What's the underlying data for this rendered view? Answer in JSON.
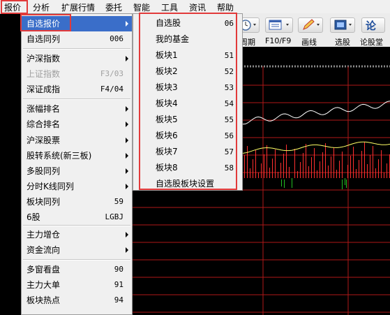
{
  "menubar": {
    "items": [
      "报价",
      "分析",
      "扩展行情",
      "委托",
      "智能",
      "工具",
      "资讯",
      "帮助"
    ]
  },
  "toolbar": {
    "labels": [
      "周期",
      "F10/F9",
      "画线",
      "选股",
      "论股堂"
    ]
  },
  "menu": {
    "items": [
      {
        "label": "自选报价",
        "shortcut": "",
        "submenu": true,
        "highlighted": true
      },
      {
        "label": "自选同列",
        "shortcut": "006"
      },
      {
        "label": "沪深指数",
        "shortcut": "",
        "submenu": true
      },
      {
        "label": "上证指数",
        "shortcut": "F3/03",
        "disabled": true
      },
      {
        "label": "深证成指",
        "shortcut": "F4/04"
      },
      {
        "label": "涨幅排名",
        "shortcut": "",
        "submenu": true
      },
      {
        "label": "综合排名",
        "shortcut": "",
        "submenu": true
      },
      {
        "label": "沪深股票",
        "shortcut": "",
        "submenu": true
      },
      {
        "label": "股转系统(新三板)",
        "shortcut": "",
        "submenu": true
      },
      {
        "label": "多股同列",
        "shortcut": "",
        "submenu": true
      },
      {
        "label": "分时K线同列",
        "shortcut": "",
        "submenu": true
      },
      {
        "label": "板块同列",
        "shortcut": "59"
      },
      {
        "label": "6股",
        "shortcut": "LGBJ"
      },
      {
        "label": "主力增仓",
        "shortcut": "",
        "submenu": true
      },
      {
        "label": "资金流向",
        "shortcut": "",
        "submenu": true
      },
      {
        "label": "多窗看盘",
        "shortcut": "90"
      },
      {
        "label": "主力大单",
        "shortcut": "91"
      },
      {
        "label": "板块热点",
        "shortcut": "94"
      }
    ]
  },
  "submenu": {
    "items": [
      {
        "label": "自选股",
        "shortcut": "06"
      },
      {
        "label": "我的基金",
        "shortcut": ""
      },
      {
        "label": "板块1",
        "shortcut": "51"
      },
      {
        "label": "板块2",
        "shortcut": "52"
      },
      {
        "label": "板块3",
        "shortcut": "53"
      },
      {
        "label": "板块4",
        "shortcut": "54"
      },
      {
        "label": "板块5",
        "shortcut": "55"
      },
      {
        "label": "板块6",
        "shortcut": "56"
      },
      {
        "label": "板块7",
        "shortcut": "57"
      },
      {
        "label": "板块8",
        "shortcut": "58"
      },
      {
        "label": "自选股板块设置",
        "shortcut": ""
      }
    ]
  },
  "colors": {
    "highlight": "#3a6ec9",
    "annotation": "#e23a3a",
    "chart_grid": "#b01818",
    "up_bar": "#ff3030",
    "down_bar": "#22c022"
  }
}
